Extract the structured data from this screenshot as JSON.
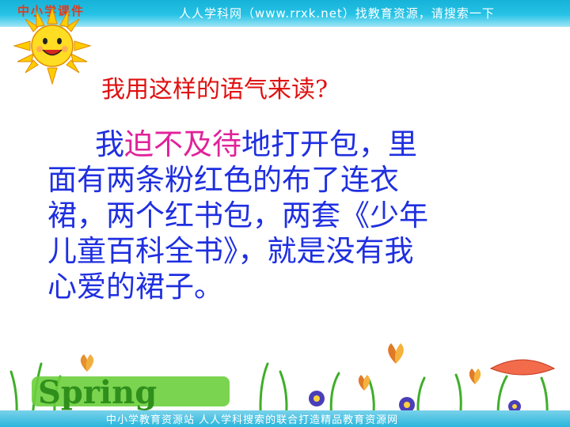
{
  "header": {
    "logo_text": "中小学课件",
    "banner_text": "人人学科网（www.rrxk.net）找教育资源，请搜索一下"
  },
  "slide": {
    "heading": "我用这样的语气来读?",
    "lines": [
      {
        "pre": "我",
        "hl": "迫不及待",
        "post": "地打开包，里"
      },
      {
        "text": "面有两条粉红色的布了连衣"
      },
      {
        "text": "裙，两个红书包，两套《少年"
      },
      {
        "text": "儿童百科全书》，就是没有我"
      },
      {
        "text": "心爱的裙子。"
      }
    ],
    "indent": "    ",
    "text_color": "#1f2fe0",
    "highlight_color": "#e0229a",
    "heading_color": "#e01010"
  },
  "footer": {
    "text": "中小学教育资源站 人人学科搜索的联合打造精品教育资源网"
  },
  "decorations": {
    "sun_icon": "sun-icon",
    "spring_word": "Spring",
    "colors": {
      "banner": "#27c3e6",
      "grass": "#5cc23a"
    }
  }
}
